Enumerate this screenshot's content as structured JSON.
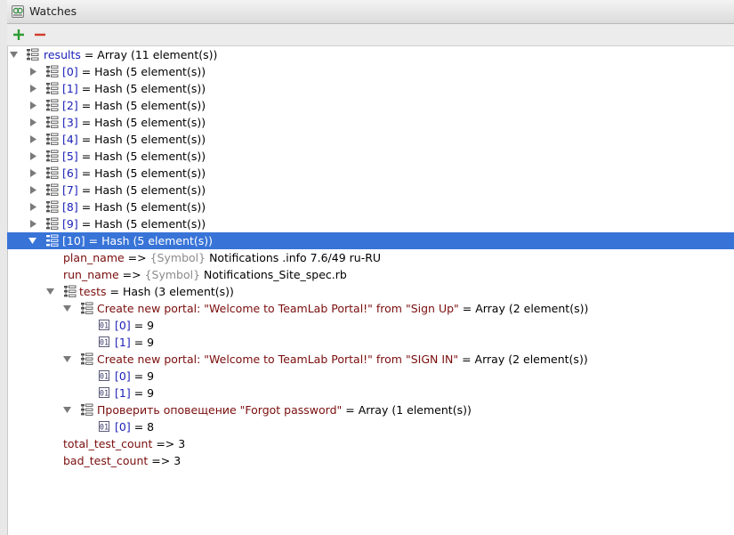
{
  "window": {
    "title": "Watches"
  },
  "toolbar": {
    "add_label": "+",
    "remove_label": "−"
  },
  "tree": {
    "results": {
      "name": "results",
      "value": " = Array (11 element(s))"
    },
    "items": [
      {
        "index": "[0]",
        "value": " = Hash (5 element(s))"
      },
      {
        "index": "[1]",
        "value": " = Hash (5 element(s))"
      },
      {
        "index": "[2]",
        "value": " = Hash (5 element(s))"
      },
      {
        "index": "[3]",
        "value": " = Hash (5 element(s))"
      },
      {
        "index": "[4]",
        "value": " = Hash (5 element(s))"
      },
      {
        "index": "[5]",
        "value": " = Hash (5 element(s))"
      },
      {
        "index": "[6]",
        "value": " = Hash (5 element(s))"
      },
      {
        "index": "[7]",
        "value": " = Hash (5 element(s))"
      },
      {
        "index": "[8]",
        "value": " = Hash (5 element(s))"
      },
      {
        "index": "[9]",
        "value": " = Hash (5 element(s))"
      }
    ],
    "selected": {
      "index": "[10]",
      "value": " = Hash (5 element(s))"
    },
    "plan_name": {
      "key": "plan_name",
      "arrow": " => ",
      "symbol": "{Symbol}",
      "value": " Notifications .info 7.6/49 ru-RU"
    },
    "run_name": {
      "key": "run_name",
      "arrow": " => ",
      "symbol": "{Symbol}",
      "value": " Notifications_Site_spec.rb"
    },
    "tests": {
      "name": "tests",
      "value": " = Hash (3 element(s))"
    },
    "test1": {
      "name": "Create new portal: \"Welcome to TeamLab Portal!\" from \"Sign Up\"",
      "value": " = Array (2 element(s))",
      "items": [
        {
          "index": "[0]",
          "value": " = 9"
        },
        {
          "index": "[1]",
          "value": " = 9"
        }
      ]
    },
    "test2": {
      "name": "Create new portal: \"Welcome to TeamLab Portal!\" from \"SIGN IN\"",
      "value": " = Array (2 element(s))",
      "items": [
        {
          "index": "[0]",
          "value": " = 9"
        },
        {
          "index": "[1]",
          "value": " = 9"
        }
      ]
    },
    "test3": {
      "name": "Проверить оповещение \"Forgot password\"",
      "value": " = Array (1 element(s))",
      "items": [
        {
          "index": "[0]",
          "value": " = 8"
        }
      ]
    },
    "total": {
      "key": "total_test_count",
      "value": " => 3"
    },
    "bad": {
      "key": "bad_test_count",
      "value": " => 3"
    }
  }
}
